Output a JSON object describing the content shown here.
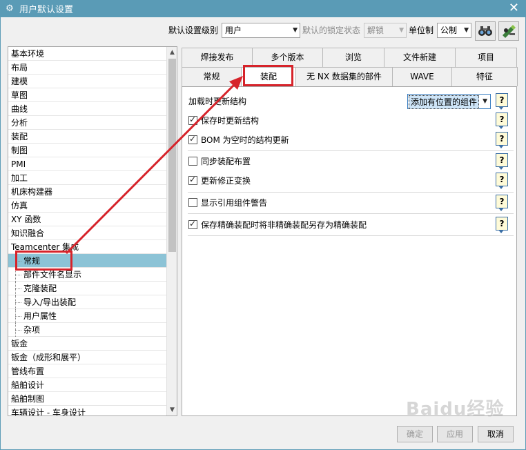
{
  "window": {
    "title": "用户默认设置",
    "close_glyph": "✕"
  },
  "toolbar": {
    "level_label": "默认设置级别",
    "level_value": "用户",
    "lock_label": "默认的锁定状态",
    "lock_value": "解锁",
    "unit_label": "单位制",
    "unit_value": "公制",
    "icons": [
      "binoculars-icon",
      "edit-defaults-icon"
    ]
  },
  "tree": {
    "items": [
      {
        "label": "基本环境"
      },
      {
        "label": "布局"
      },
      {
        "label": "建模"
      },
      {
        "label": "草图"
      },
      {
        "label": "曲线"
      },
      {
        "label": "分析"
      },
      {
        "label": "装配"
      },
      {
        "label": "制图"
      },
      {
        "label": "PMI"
      },
      {
        "label": "加工"
      },
      {
        "label": "机床构建器"
      },
      {
        "label": "仿真"
      },
      {
        "label": "XY 函数"
      },
      {
        "label": "知识融合"
      },
      {
        "label": "Teamcenter 集成"
      },
      {
        "label": "常规"
      },
      {
        "label": "部件文件名显示"
      },
      {
        "label": "克隆装配"
      },
      {
        "label": "导入/导出装配"
      },
      {
        "label": "用户属性"
      },
      {
        "label": "杂项"
      },
      {
        "label": "钣金"
      },
      {
        "label": "钣金（成形和展平）"
      },
      {
        "label": "管线布置"
      },
      {
        "label": "船舶设计"
      },
      {
        "label": "船舶制图"
      },
      {
        "label": "车辆设计 - 车身设计"
      }
    ],
    "selected": "常规"
  },
  "tabs": {
    "row1": [
      "焊接发布",
      "多个版本",
      "浏览",
      "文件新建",
      "项目"
    ],
    "row2": [
      "常规",
      "装配",
      "无 NX 数据集的部件",
      "WAVE",
      "特征"
    ],
    "active": "装配"
  },
  "panel": {
    "load_label": "加载时更新结构",
    "load_value": "添加有位置的组件",
    "options": [
      {
        "label": "保存时更新结构",
        "checked": true
      },
      {
        "label": "BOM 为空时的结构更新",
        "checked": true
      },
      {
        "label": "同步装配布置",
        "checked": false
      },
      {
        "label": "更新修正变换",
        "checked": true
      },
      {
        "label": "显示引用组件警告",
        "checked": false
      },
      {
        "label": "保存精确装配时将非精确装配另存为精确装配",
        "checked": true
      }
    ],
    "help_glyph": "?"
  },
  "buttons": {
    "ok": "确定",
    "apply": "应用",
    "cancel": "取消"
  },
  "watermark": "Baidu经验",
  "colors": {
    "titlebar": "#5a9bb6",
    "selection": "#8cc3d6",
    "annotation": "#d6232a"
  }
}
